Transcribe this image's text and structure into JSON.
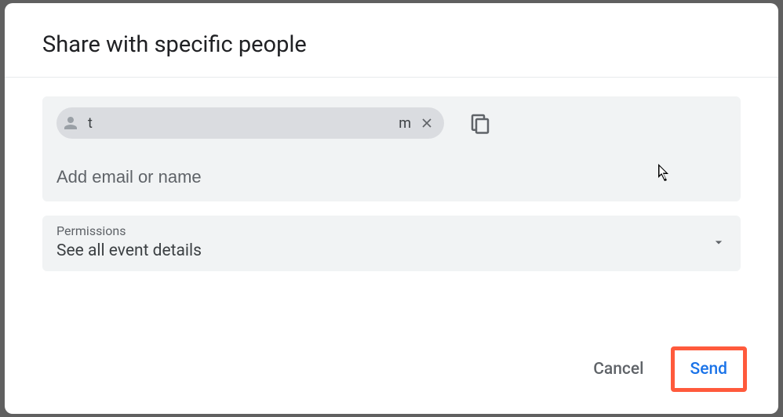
{
  "title": "Share with specific people",
  "chip": {
    "left": "t",
    "right": "m"
  },
  "add_placeholder": "Add email or name",
  "permissions": {
    "label": "Permissions",
    "value": "See all event details"
  },
  "buttons": {
    "cancel": "Cancel",
    "send": "Send"
  }
}
